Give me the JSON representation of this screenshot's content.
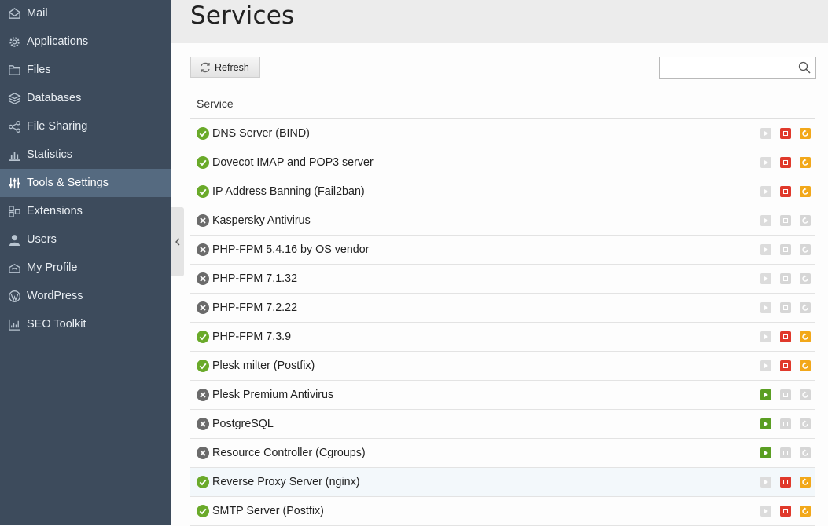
{
  "sidebar": {
    "items": [
      {
        "label": "Mail",
        "icon": "mail-icon"
      },
      {
        "label": "Applications",
        "icon": "gear-icon"
      },
      {
        "label": "Files",
        "icon": "folder-icon"
      },
      {
        "label": "Databases",
        "icon": "layers-icon"
      },
      {
        "label": "File Sharing",
        "icon": "share-icon"
      },
      {
        "label": "Statistics",
        "icon": "bar-chart-icon"
      },
      {
        "label": "Tools & Settings",
        "icon": "sliders-icon",
        "active": true
      },
      {
        "label": "Extensions",
        "icon": "extensions-icon"
      },
      {
        "label": "Users",
        "icon": "user-icon"
      },
      {
        "label": "My Profile",
        "icon": "profile-icon"
      },
      {
        "label": "WordPress",
        "icon": "wordpress-icon"
      },
      {
        "label": "SEO Toolkit",
        "icon": "seo-chart-icon"
      }
    ]
  },
  "header": {
    "title": "Services"
  },
  "toolbar": {
    "refresh_label": "Refresh",
    "search_placeholder": "",
    "search_value": ""
  },
  "table": {
    "column_header": "Service",
    "rows": [
      {
        "name": "DNS Server (BIND)",
        "running": true
      },
      {
        "name": "Dovecot IMAP and POP3 server",
        "running": true
      },
      {
        "name": "IP Address Banning (Fail2ban)",
        "running": true
      },
      {
        "name": "Kaspersky Antivirus",
        "running": false,
        "startable": false
      },
      {
        "name": "PHP-FPM 5.4.16 by OS vendor",
        "running": false,
        "startable": false
      },
      {
        "name": "PHP-FPM 7.1.32",
        "running": false,
        "startable": false
      },
      {
        "name": "PHP-FPM 7.2.22",
        "running": false,
        "startable": false
      },
      {
        "name": "PHP-FPM 7.3.9",
        "running": true
      },
      {
        "name": "Plesk milter (Postfix)",
        "running": true
      },
      {
        "name": "Plesk Premium Antivirus",
        "running": false,
        "startable": true
      },
      {
        "name": "PostgreSQL",
        "running": false,
        "startable": true
      },
      {
        "name": "Resource Controller (Cgroups)",
        "running": false,
        "startable": true
      },
      {
        "name": "Reverse Proxy Server (nginx)",
        "running": true,
        "hover": true
      },
      {
        "name": "SMTP Server (Postfix)",
        "running": true
      }
    ]
  },
  "colors": {
    "sidebar_bg": "#3d4b5c",
    "sidebar_active": "#556a80",
    "status_ok": "#6aaa2a",
    "status_off": "#6b6b6b",
    "start": "#5a9e22",
    "stop": "#e0392b",
    "restart": "#f2a81a"
  }
}
